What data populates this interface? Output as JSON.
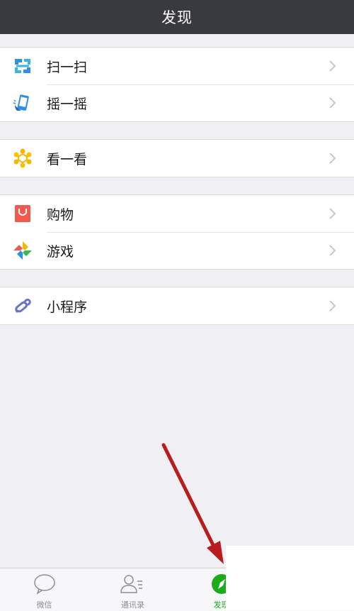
{
  "header": {
    "title": "发现"
  },
  "menu": {
    "scan": {
      "label": "扫一扫",
      "icon": "scan-icon"
    },
    "shake": {
      "label": "摇一摇",
      "icon": "shake-icon"
    },
    "top_stories": {
      "label": "看一看",
      "icon": "top-stories-icon"
    },
    "shopping": {
      "label": "购物",
      "icon": "shopping-bag-icon"
    },
    "games": {
      "label": "游戏",
      "icon": "games-icon"
    },
    "mini_programs": {
      "label": "小程序",
      "icon": "mini-program-icon"
    }
  },
  "tabbar": {
    "chats": {
      "label": "微信",
      "icon": "chat-bubble-icon"
    },
    "contacts": {
      "label": "通讯录",
      "icon": "contacts-icon"
    },
    "discover": {
      "label": "发现",
      "icon": "compass-icon"
    }
  },
  "colors": {
    "header_bg": "#393a3f",
    "page_bg": "#efeff4",
    "active_green": "#1aad19",
    "arrow_red": "#b81c1c"
  }
}
